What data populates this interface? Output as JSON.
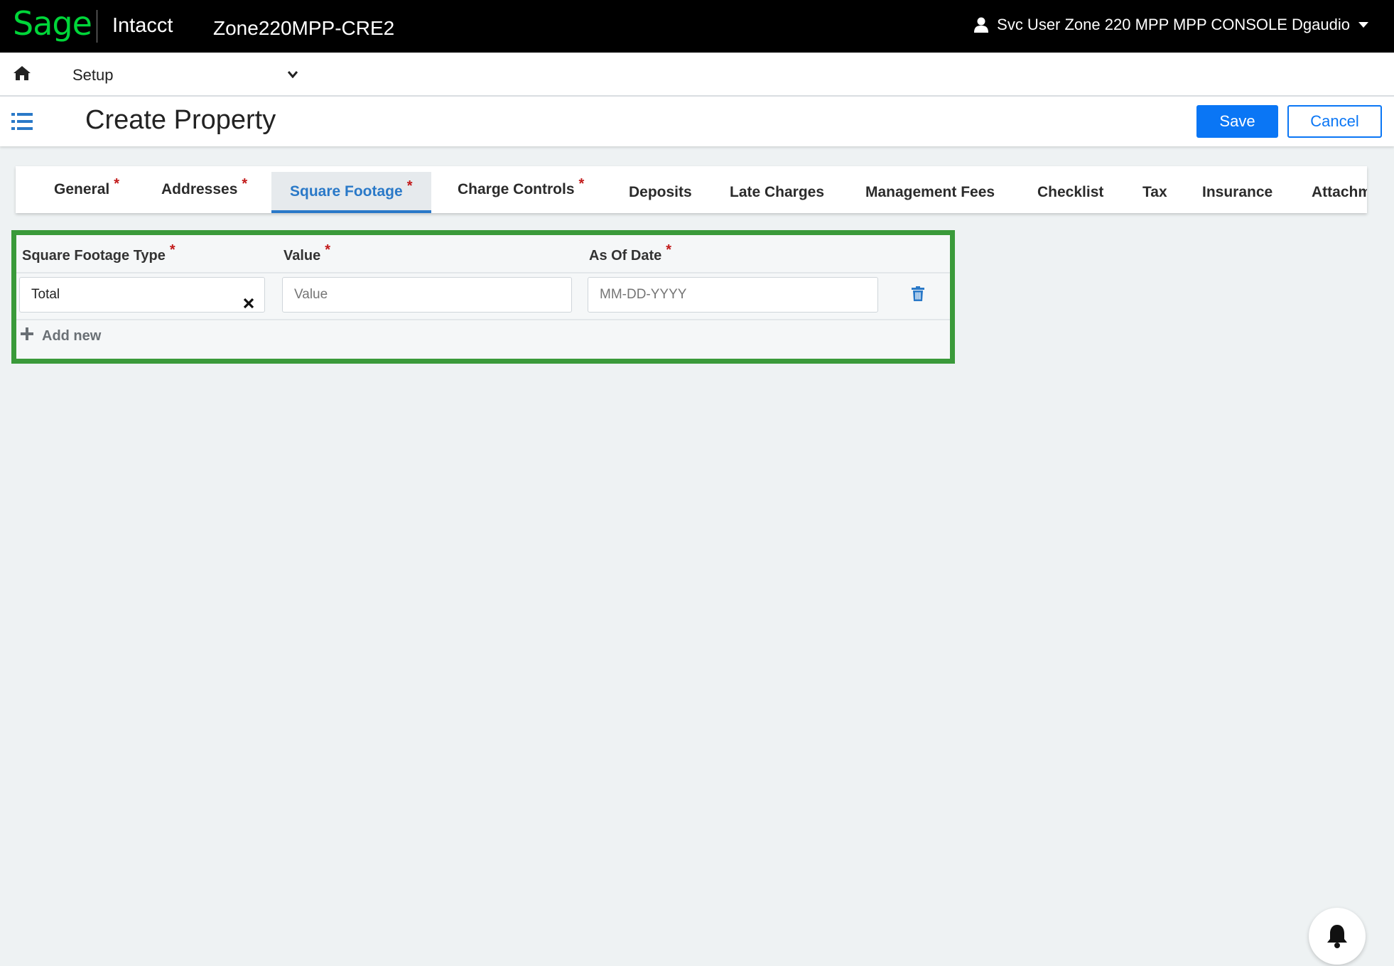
{
  "topbar": {
    "logo_text": "Sage",
    "product": "Intacct",
    "company": "Zone220MPP-CRE2",
    "user_name": "Svc User Zone 220 MPP MPP CONSOLE Dgaudio",
    "brand_color": "#00d639"
  },
  "setupbar": {
    "menu_label": "Setup"
  },
  "header": {
    "title": "Create Property",
    "save_label": "Save",
    "cancel_label": "Cancel",
    "accent_color": "#0a76f5"
  },
  "tabs": [
    {
      "label": "General",
      "required": "*"
    },
    {
      "label": "Addresses",
      "required": "*"
    },
    {
      "label": "Square Footage",
      "required": "*",
      "active": true
    },
    {
      "label": "Charge Controls",
      "required": "*"
    },
    {
      "label": "Deposits"
    },
    {
      "label": "Late Charges"
    },
    {
      "label": "Management Fees"
    },
    {
      "label": "Checklist"
    },
    {
      "label": "Tax"
    },
    {
      "label": "Insurance"
    },
    {
      "label": "Attachmen"
    }
  ],
  "grid": {
    "columns": [
      {
        "label": "Square Footage Type",
        "required": "*"
      },
      {
        "label": "Value",
        "required": "*"
      },
      {
        "label": "As Of Date",
        "required": "*"
      }
    ],
    "row": {
      "type_value": "Total",
      "value_placeholder": "Value",
      "date_placeholder": "MM-DD-YYYY"
    },
    "add_new_label": "Add new",
    "highlight_color": "#3a9a3a"
  }
}
